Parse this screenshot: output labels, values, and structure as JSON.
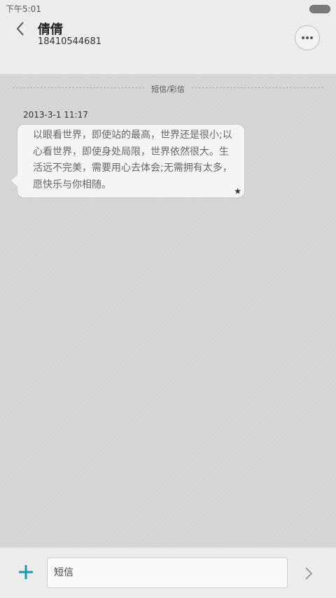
{
  "status_bar": {
    "time": "下午5:01"
  },
  "header": {
    "contact_name": "倩倩",
    "phone_number": "18410544681"
  },
  "conversation": {
    "divider_label": "短信/彩信",
    "messages": [
      {
        "timestamp": "2013-3-1 11:17",
        "text": "以眼看世界，即使站的最高，世界还是很小;以心看世界，即使身处局限，世界依然很大。生活远不完美，需要用心去体会;无需拥有太多，愿快乐与你相随。",
        "starred": true
      }
    ]
  },
  "composer": {
    "placeholder": "短信"
  },
  "colors": {
    "accent": "#1a98b0",
    "background": "#d5d5d5",
    "bubble": "#f5f5f5"
  },
  "icons": {
    "back": "chevron-left-icon",
    "more": "ellipsis-icon",
    "star": "star-icon",
    "add": "plus-icon",
    "send": "chevron-right-icon"
  }
}
